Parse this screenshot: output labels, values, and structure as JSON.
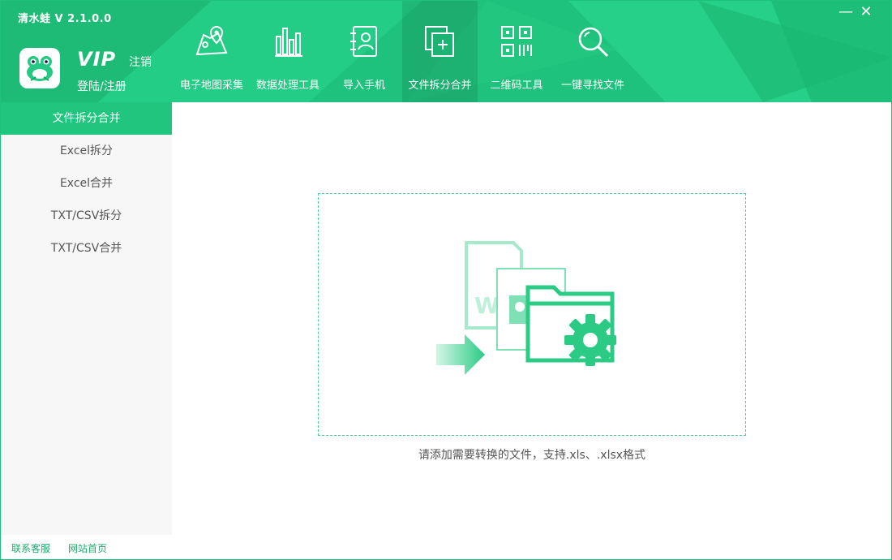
{
  "app": {
    "title": "清水蛙  V 2.1.0.0"
  },
  "window_controls": {
    "minimize": "—",
    "close": "✕"
  },
  "account": {
    "vip_label": "VIP",
    "logout_label": "注销",
    "login_label": "登陆/注册"
  },
  "toolbar": [
    {
      "label": "电子地图采集",
      "icon": "map-pin-icon"
    },
    {
      "label": "数据处理工具",
      "icon": "bar-chart-icon"
    },
    {
      "label": "导入手机",
      "icon": "contact-book-icon"
    },
    {
      "label": "文件拆分合并",
      "icon": "file-split-icon",
      "active": true
    },
    {
      "label": "二维码工具",
      "icon": "qr-code-icon"
    },
    {
      "label": "一键寻找文件",
      "icon": "search-icon"
    }
  ],
  "sidebar": {
    "items": [
      {
        "label": "文件拆分合并",
        "active": true
      },
      {
        "label": "Excel拆分"
      },
      {
        "label": "Excel合并"
      },
      {
        "label": "TXT/CSV拆分"
      },
      {
        "label": "TXT/CSV合并"
      }
    ],
    "footer": {
      "contact": "联系客服",
      "website": "网站首页"
    }
  },
  "main": {
    "drop_icon": "file-folder-gear-icon",
    "hint": "请添加需要转换的文件，支持.xls、.xlsx格式"
  },
  "colors": {
    "brand": "#20c57e",
    "brand_light": "#7fe0b5",
    "text": "#555555"
  }
}
